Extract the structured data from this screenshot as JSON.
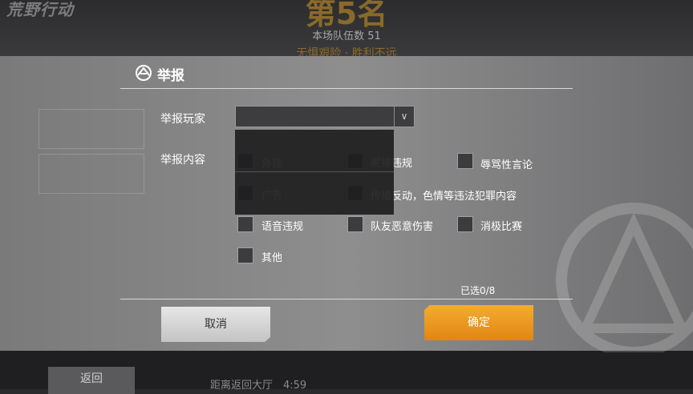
{
  "background": {
    "logo_text": "荒野行动",
    "rank": "第5名",
    "team_count": "本场队伍数 51",
    "slogan": "无惧艰险 · 胜利不远",
    "back_label": "返回",
    "countdown": "距离返回大厅　4:59"
  },
  "dialog": {
    "title": "举报",
    "player_label": "举报玩家",
    "player_value": "",
    "content_label": "举报内容",
    "options": [
      {
        "label": "外挂",
        "checked": false
      },
      {
        "label": "昵称违规",
        "checked": false
      },
      {
        "label": "辱骂性言论",
        "checked": false
      },
      {
        "label": "广告",
        "checked": false
      },
      {
        "label": "传播反动，色情等违法犯罪内容",
        "checked": false
      },
      {
        "label": "语音违规",
        "checked": false
      },
      {
        "label": "队友恶意伤害",
        "checked": false
      },
      {
        "label": "消极比赛",
        "checked": false
      },
      {
        "label": "其他",
        "checked": false
      }
    ],
    "selected_count": "已选0/8",
    "cancel_label": "取消",
    "confirm_label": "确定"
  },
  "colors": {
    "confirm": "#f0a020",
    "cancel": "#d8d8d8"
  }
}
